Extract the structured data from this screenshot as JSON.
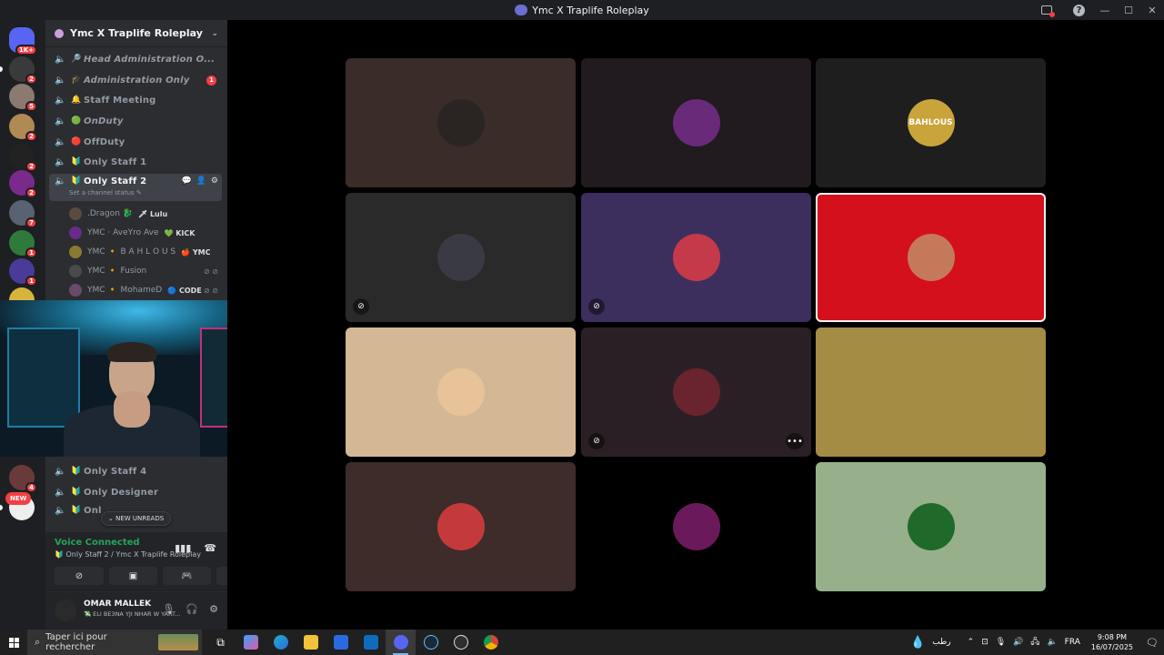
{
  "window": {
    "title": "Ymc X Traplife Roleplay"
  },
  "guilds": {
    "items": [
      {
        "badge": "1K+",
        "color": "#5865f2"
      },
      {
        "badge": "2",
        "color": "#3a3a3a"
      },
      {
        "badge": "5",
        "color": "#8a7a70"
      },
      {
        "badge": "2",
        "color": "#b08a55"
      },
      {
        "badge": "2",
        "color": "#222222"
      },
      {
        "badge": "2",
        "color": "#7a2a8a"
      },
      {
        "badge": "7",
        "color": "#596273"
      },
      {
        "badge": "1",
        "color": "#2f7a3a"
      },
      {
        "badge": "1",
        "color": "#4a3a9a"
      },
      {
        "badge": "",
        "color": "#d7b43a"
      },
      {
        "badge": "4",
        "color": "#6a3a3a"
      },
      {
        "badge": "",
        "color": "#eeeeee"
      }
    ],
    "new_label": "NEW"
  },
  "server": {
    "name": "Ymc X Traplife Roleplay"
  },
  "channels": {
    "head_admin": {
      "emoji": "🔎",
      "name": "Head Administration O..."
    },
    "admin_only": {
      "emoji": "🎓",
      "name": "Administration Only",
      "unread": "1"
    },
    "staff_meeting": {
      "emoji": "🔔",
      "name": "Staff Meeting"
    },
    "on_duty": {
      "emoji": "🟢",
      "name": "OnDuty"
    },
    "off_duty": {
      "emoji": "🔴",
      "name": "OffDuty"
    },
    "only_staff_1": {
      "emoji": "🔰",
      "name": "Only Staff 1"
    },
    "only_staff_2": {
      "emoji": "🔰",
      "name": "Only Staff 2",
      "status": "Set a channel status ✎"
    },
    "only_staff_4": {
      "emoji": "🔰",
      "name": "Only Staff 4"
    },
    "only_designer": {
      "emoji": "🔰",
      "name": "Only Designer"
    },
    "only_partial": {
      "emoji": "🔰",
      "name": "Onl"
    }
  },
  "members": [
    {
      "name": ".Dragon 🐉",
      "tag": "🗡 Lulu",
      "color": "#5a4a40"
    },
    {
      "name": "YMC · AveYro Ave",
      "tag": "💚 KICK",
      "color": "#6a2a8a"
    },
    {
      "name": "YMC 🔸 B A H L O U S",
      "tag": "🍎 YMC",
      "color": "#8a7a30"
    },
    {
      "name": "YMC 🔸 Fusion",
      "tag": "",
      "color": "#4a4a4a"
    },
    {
      "name": "YMC 🔸 MohameD",
      "tag": "🔵 CODE",
      "color": "#6a4a6a"
    }
  ],
  "new_unreads": "⌄  NEW UNREADS",
  "voice": {
    "connected_label": "Voice Connected",
    "channel_path": "🔰 Only Staff 2 / Ymc X Traplife Roleplay"
  },
  "user": {
    "name": "OMAR MALLEK",
    "status": "💸 ELI BE3NA YJI NHAR W YART..."
  },
  "tiles": [
    {
      "bg": "#3a2c28",
      "avatar": "#2a2523",
      "muted": false,
      "speaking": false,
      "label": ""
    },
    {
      "bg": "#211a1f",
      "avatar": "#6a2a7a",
      "muted": false,
      "speaking": false,
      "label": ""
    },
    {
      "bg": "#1e1e1e",
      "avatar": "#c9a43a",
      "muted": false,
      "speaking": false,
      "label": "BAHLOUS"
    },
    {
      "bg": "#2a2a2a",
      "avatar": "#3a3a44",
      "muted": true,
      "speaking": false,
      "label": ""
    },
    {
      "bg": "#3c2f5e",
      "avatar": "#c43a4a",
      "muted": true,
      "speaking": false,
      "label": ""
    },
    {
      "bg": "#d4101d",
      "avatar": "#c47a5a",
      "muted": false,
      "speaking": true,
      "label": ""
    },
    {
      "bg": "#d4b895",
      "avatar": "#e8c39a",
      "muted": false,
      "speaking": false,
      "label": ""
    },
    {
      "bg": "#2b1f26",
      "avatar": "#6a2430",
      "muted": true,
      "speaking": false,
      "label": "",
      "more": true
    },
    {
      "bg": "#a48c45",
      "avatar": "#a48c45",
      "muted": false,
      "speaking": false,
      "label": ""
    },
    {
      "bg": "#3d2c2a",
      "avatar": "#c43a3a",
      "muted": false,
      "speaking": false,
      "label": ""
    },
    {
      "bg": "#000000",
      "avatar": "#6a1a5a",
      "muted": false,
      "speaking": false,
      "label": ""
    },
    {
      "bg": "#97b08b",
      "avatar": "#1f6a2a",
      "muted": false,
      "speaking": false,
      "label": ""
    }
  ],
  "taskbar": {
    "search_placeholder": "Taper ici pour rechercher",
    "weather": "رطب",
    "language": "FRA",
    "time": "9:08 PM",
    "date": "16/07/2025",
    "notif_count": "3"
  }
}
